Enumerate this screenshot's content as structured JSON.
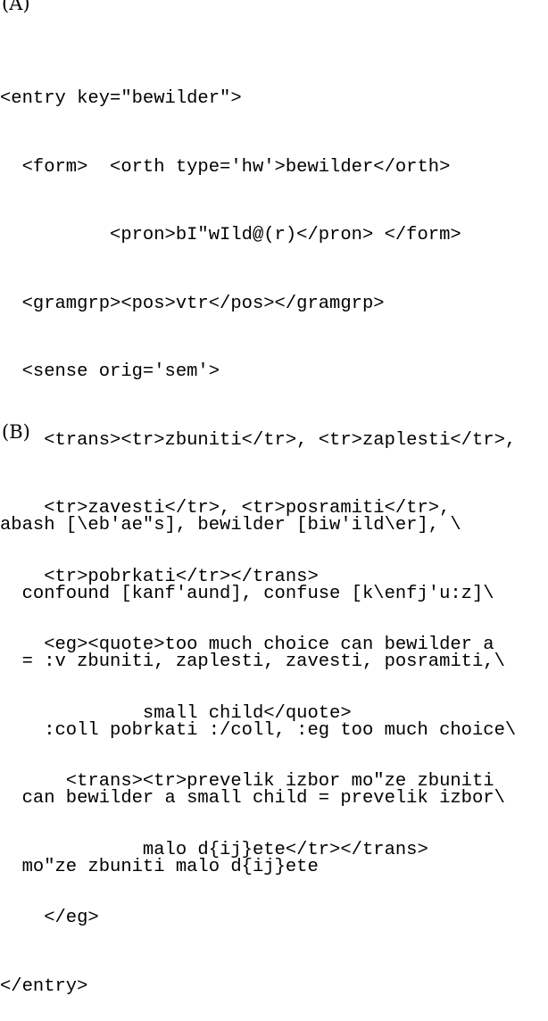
{
  "section_a": {
    "label": "(A)",
    "lines": [
      "<entry key=\"bewilder\">",
      "  <form>  <orth type='hw'>bewilder</orth>",
      "          <pron>bI\"wIld@(r)</pron> </form>",
      "  <gramgrp><pos>vtr</pos></gramgrp>",
      "  <sense orig='sem'>",
      "    <trans><tr>zbuniti</tr>, <tr>zaplesti</tr>,",
      "    <tr>zavesti</tr>, <tr>posramiti</tr>,",
      "    <tr>pobrkati</tr></trans>",
      "    <eg><quote>too much choice can bewilder a",
      "             small child</quote>",
      "      <trans><tr>prevelik izbor mo\"ze zbuniti",
      "             malo d{ij}ete</tr></trans>",
      "    </eg>",
      "</entry>"
    ]
  },
  "section_b": {
    "label": "(B)",
    "lines": [
      "abash [\\eb'ae\"s], bewilder [biw'ild\\er], \\",
      "  confound [kanf'aund], confuse [k\\enfj'u:z]\\",
      "  = :v zbuniti, zaplesti, zavesti, posramiti,\\",
      "    :coll pobrkati :/coll, :eg too much choice\\",
      "  can bewilder a small child = prevelik izbor\\",
      "  mo\"ze zbuniti malo d{ij}ete"
    ]
  }
}
